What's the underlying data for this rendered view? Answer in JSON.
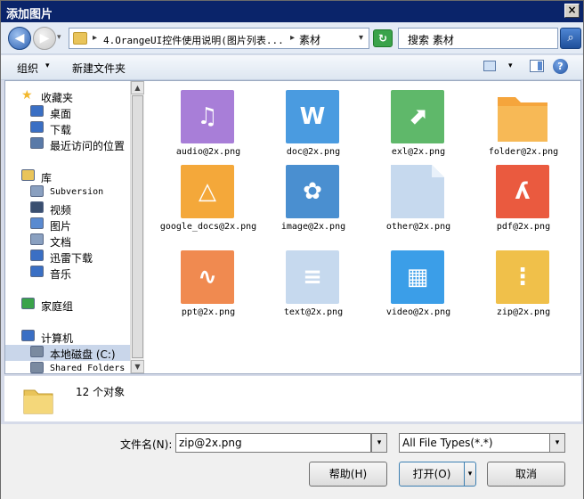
{
  "window": {
    "title": "添加图片",
    "close": "×"
  },
  "nav": {
    "back": "◀",
    "forward": "▶",
    "history_arrow": "▾",
    "sep": "▸",
    "crumb1": "4.OrangeUI控件使用说明(图片列表...",
    "crumb2": "素材",
    "dropdown": "▾",
    "refresh": "↻",
    "search_text": "搜索 素材",
    "search_icon": "⌕"
  },
  "toolbar": {
    "organize": "组织",
    "organize_arrow": "▾",
    "new_folder": "新建文件夹",
    "view_arrow": "▾",
    "help": "?"
  },
  "sidebar": {
    "items": [
      {
        "label": "收藏夹",
        "icon": "star-icon",
        "color": "#f2b82e"
      },
      {
        "label": "桌面",
        "icon": "desktop-icon",
        "color": "#3a6fc4"
      },
      {
        "label": "下载",
        "icon": "downloads-icon",
        "color": "#3a6fc4"
      },
      {
        "label": "最近访问的位置",
        "icon": "recent-places-icon",
        "color": "#5a7aa8"
      },
      {
        "label": "库",
        "icon": "libraries-icon",
        "color": "#e9c45a"
      },
      {
        "label": "Subversion",
        "icon": "document-icon",
        "color": "#8aa0c0"
      },
      {
        "label": "视频",
        "icon": "video-icon",
        "color": "#3a4f70"
      },
      {
        "label": "图片",
        "icon": "pictures-icon",
        "color": "#5a8ad0"
      },
      {
        "label": "文档",
        "icon": "document-icon",
        "color": "#8aa0c0"
      },
      {
        "label": "迅雷下载",
        "icon": "thunder-icon",
        "color": "#3a6fc4"
      },
      {
        "label": "音乐",
        "icon": "music-icon",
        "color": "#3a6fc4"
      },
      {
        "label": "家庭组",
        "icon": "homegroup-icon",
        "color": "#3aa34a"
      },
      {
        "label": "计算机",
        "icon": "computer-icon",
        "color": "#3a6fc4"
      },
      {
        "label": "本地磁盘 (C:)",
        "icon": "disk-icon",
        "color": "#7a8aa0"
      },
      {
        "label": "Shared Folders",
        "icon": "network-drive-icon",
        "color": "#7a8aa0"
      }
    ]
  },
  "files": [
    {
      "name": "audio@2x.png",
      "color": "#a87ed8",
      "glyph": "♫"
    },
    {
      "name": "doc@2x.png",
      "color": "#4a9be0",
      "glyph": "W"
    },
    {
      "name": "exl@2x.png",
      "color": "#5fb86a",
      "glyph": "⬈"
    },
    {
      "name": "folder@2x.png",
      "color": "#f6b04a",
      "glyph": ""
    },
    {
      "name": "google_docs@2x.png",
      "color": "#f4a83a",
      "glyph": "△"
    },
    {
      "name": "image@2x.png",
      "color": "#4a8fd0",
      "glyph": "✿"
    },
    {
      "name": "other@2x.png",
      "color": "#c6d9ee",
      "glyph": ""
    },
    {
      "name": "pdf@2x.png",
      "color": "#ea5a3f",
      "glyph": "ʎ"
    },
    {
      "name": "ppt@2x.png",
      "color": "#f08a50",
      "glyph": "∿"
    },
    {
      "name": "text@2x.png",
      "color": "#c6d9ee",
      "glyph": "≡"
    },
    {
      "name": "video@2x.png",
      "color": "#3b9ee8",
      "glyph": "▦"
    },
    {
      "name": "zip@2x.png",
      "color": "#f0c04a",
      "glyph": "⋮"
    }
  ],
  "status": {
    "count": "12 个对象"
  },
  "footer": {
    "filename_label": "文件名(N):",
    "filename_value": "zip@2x.png",
    "filetype_value": "All File Types(*.*)",
    "dropdown": "▾",
    "help_button": "帮助(H)",
    "open_button": "打开(O)",
    "cancel_button": "取消"
  }
}
